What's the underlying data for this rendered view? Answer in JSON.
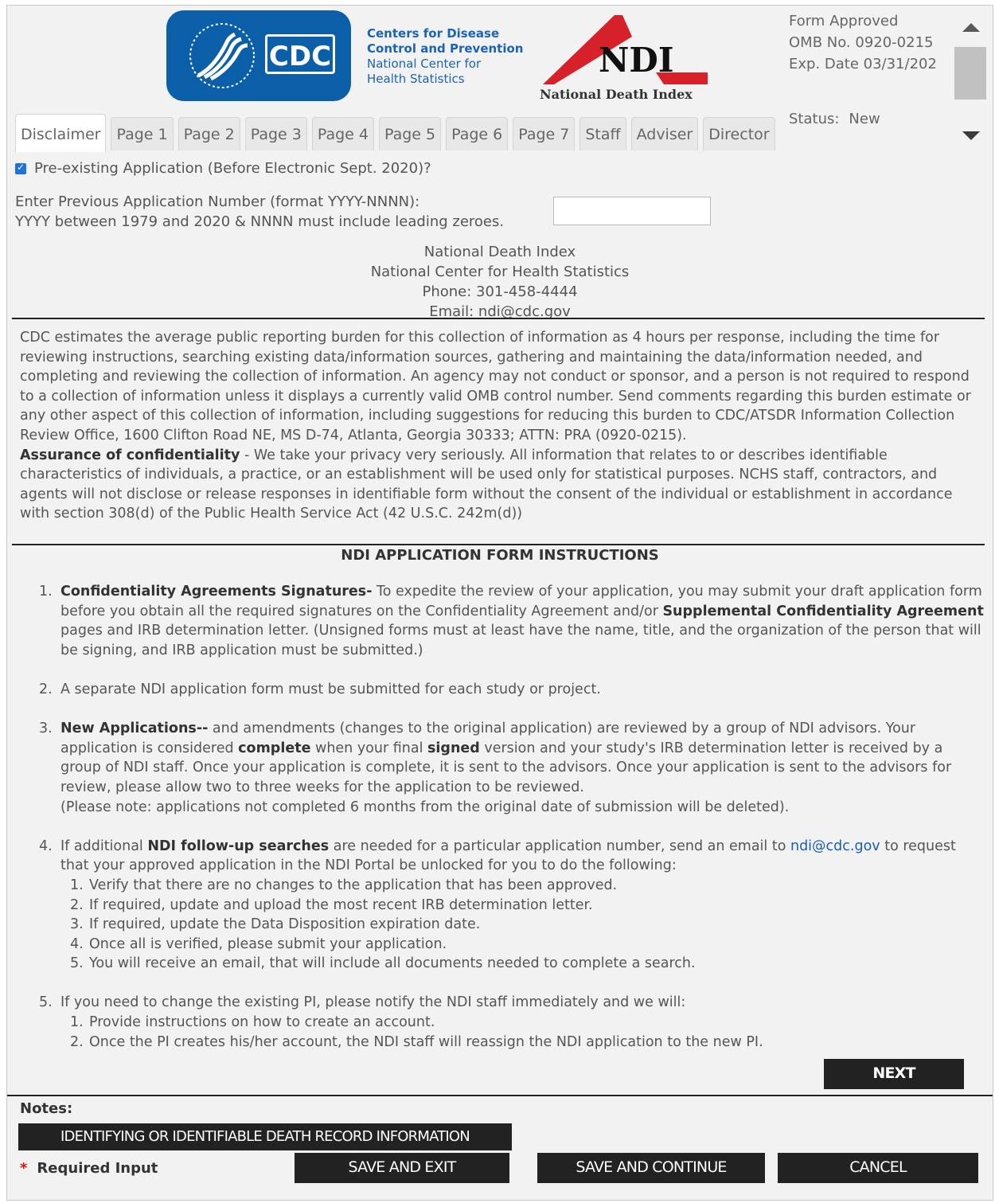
{
  "header": {
    "cdc_logo_text": "CDC",
    "cdc_name_lines": [
      "Centers for Disease",
      "Control and Prevention",
      "National Center for",
      "Health Statistics"
    ],
    "ndi_logo_text": "NDI",
    "ndi_logo_subtitle": "National Death Index",
    "form_approved": [
      "Form Approved",
      "OMB No. 0920-0215",
      "Exp. Date 03/31/202"
    ],
    "status_label": "Status:",
    "status_value": "New"
  },
  "tabs": [
    "Disclaimer",
    "Page 1",
    "Page 2",
    "Page 3",
    "Page 4",
    "Page 5",
    "Page 6",
    "Page 7",
    "Staff",
    "Adviser",
    "Director"
  ],
  "active_tab": "Disclaimer",
  "pre_existing": {
    "label": "Pre-existing Application (Before Electronic Sept. 2020)?",
    "checked": true
  },
  "previous_application": {
    "label_line1": "Enter Previous Application Number (format YYYY-NNNN):",
    "label_line2": "YYYY between 1979 and 2020 & NNNN must include leading zeroes.",
    "value": ""
  },
  "contact": {
    "line1": "National Death Index",
    "line2": "National Center for Health Statistics",
    "line3": "Phone: 301-458-4444",
    "line4": "Email: ndi@cdc.gov"
  },
  "burden": {
    "paragraph": "CDC estimates the average public reporting burden for this collection of information as 4 hours per response, including the time for reviewing instructions, searching existing data/information sources, gathering and maintaining the data/information needed, and completing and reviewing the collection of information. An agency may not conduct or sponsor, and a person is not required to respond to a collection of information unless it displays a currently valid OMB control number. Send comments regarding this burden estimate or any other aspect of this collection of information, including suggestions for reducing this burden to CDC/ATSDR Information Collection Review Office, 1600 Clifton Road NE, MS D-74, Atlanta, Georgia 30333; ATTN: PRA (0920-0215).",
    "assurance_title": "Assurance of confidentiality",
    "assurance_text": " - We take your privacy very seriously. All information that relates to or describes identifiable characteristics of individuals, a practice, or an establishment will be used only for statistical purposes. NCHS staff, contractors, and agents will not disclose or release responses in identifiable form without the consent of the individual or establishment in accordance with section 308(d) of the Public Health Service Act (42 U.S.C. 242m(d))"
  },
  "instructions": {
    "title": "NDI APPLICATION FORM INSTRUCTIONS",
    "item1": {
      "num": "1.",
      "bold1": "Confidentiality Agreements Signatures-",
      "text1": " To expedite the review of your application, you may submit your draft application form before you obtain all the required signatures on the Confidentiality Agreement and/or ",
      "bold2": "Supplemental Confidentiality Agreement",
      "text2": " pages and IRB determination letter. (Unsigned forms must at least have the name, title, and the organization of the person that will be signing, and IRB application must be submitted.)"
    },
    "item2": {
      "num": "2.",
      "text": "A separate NDI application form must be submitted for each study or project."
    },
    "item3": {
      "num": "3.",
      "bold1": "New Applications--",
      "text1": " and amendments (changes to the original application) are reviewed by a group of NDI advisors. Your application is considered ",
      "bold2": "complete",
      "text2": " when your final ",
      "bold3": "signed",
      "text3": " version and your study's IRB determination letter is received by a group of NDI staff. Once your application is complete, it is sent to the advisors. Once your application is sent to the advisors for review, please allow two to three weeks for the application to be reviewed.",
      "note": "(Please note: applications not completed 6 months from the original date of submission will be deleted)."
    },
    "item4": {
      "num": "4.",
      "text1": "If additional ",
      "bold1": "NDI follow-up searches",
      "text2": " are needed for a particular application number, send an email to ",
      "link": "ndi@cdc.gov",
      "text3": " to request that your approved application in the NDI Portal be unlocked for you to do the following:",
      "subitems": [
        "Verify that there are no changes to the application that has been approved.",
        "If required, update and upload the most recent IRB determination letter.",
        "If required, update the Data Disposition expiration date.",
        "Once all is verified, please submit your application.",
        "You will receive an email, that will include all documents needed to complete a search."
      ]
    },
    "item5": {
      "num": "5.",
      "text": "If you need to change the existing PI, please notify the NDI staff immediately and we will:",
      "subitems": [
        "Provide instructions on how to create an account.",
        "Once the PI creates his/her account, the NDI staff will reassign the NDI application to the new PI."
      ]
    }
  },
  "buttons": {
    "next": "NEXT",
    "identifying": "IDENTIFYING OR IDENTIFIABLE DEATH RECORD INFORMATION",
    "save_exit": "SAVE AND EXIT",
    "save_continue": "SAVE AND CONTINUE",
    "cancel": "CANCEL"
  },
  "notes_label": "Notes:",
  "required": {
    "star": "*",
    "label": "Required Input"
  },
  "colors": {
    "cdc_blue": "#0b5fa8",
    "ndi_red": "#d6202a",
    "button_dark": "#222222",
    "link_blue": "#1a5fb4"
  }
}
